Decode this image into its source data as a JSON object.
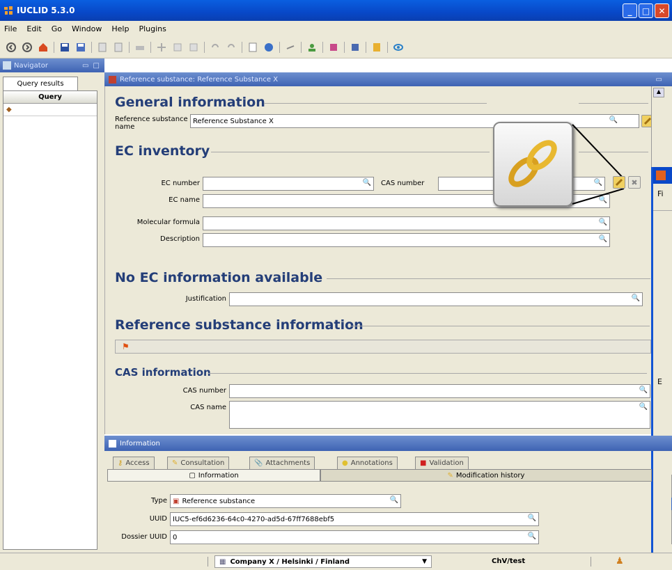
{
  "window": {
    "title": "IUCLID 5.3.0"
  },
  "menu": [
    "File",
    "Edit",
    "Go",
    "Window",
    "Help",
    "Plugins"
  ],
  "nav": {
    "header": "Navigator",
    "tab": "Query results",
    "column": "Query"
  },
  "editor": {
    "header": "Reference substance: Reference Substance X",
    "general": {
      "title": "General information",
      "name_label": "Reference substance name",
      "name_value": "Reference Substance X"
    },
    "ec": {
      "title": "EC inventory",
      "ec_number_label": "EC number",
      "cas_number_label": "CAS number",
      "ec_name_label": "EC name",
      "formula_label": "Molecular formula",
      "description_label": "Description"
    },
    "no_ec": {
      "title": "No EC information available",
      "justification_label": "Justification"
    },
    "ref_info": {
      "title": "Reference substance information"
    },
    "cas_info": {
      "title": "CAS information",
      "cas_number_label": "CAS number",
      "cas_name_label": "CAS name"
    }
  },
  "dialog": {
    "partial_title": "Fi",
    "partial_text": "E"
  },
  "info": {
    "header": "Information",
    "tabs_top": [
      "Access",
      "Consultation",
      "Attachments",
      "Annotations",
      "Validation"
    ],
    "tabs_bottom": [
      "Information",
      "Modification history"
    ],
    "type_label": "Type",
    "type_value": "Reference substance",
    "uuid_label": "UUID",
    "uuid_value": "IUC5-ef6d6236-64c0-4270-ad5d-67ff7688ebf5",
    "dossier_label": "Dossier UUID",
    "dossier_value": "0"
  },
  "status": {
    "location": "Company X / Helsinki / Finland",
    "user": "ChV/test"
  },
  "colors": {
    "title_blue": "#0848c8",
    "section_blue": "#243e78",
    "panel_bg": "#ece9d8"
  }
}
